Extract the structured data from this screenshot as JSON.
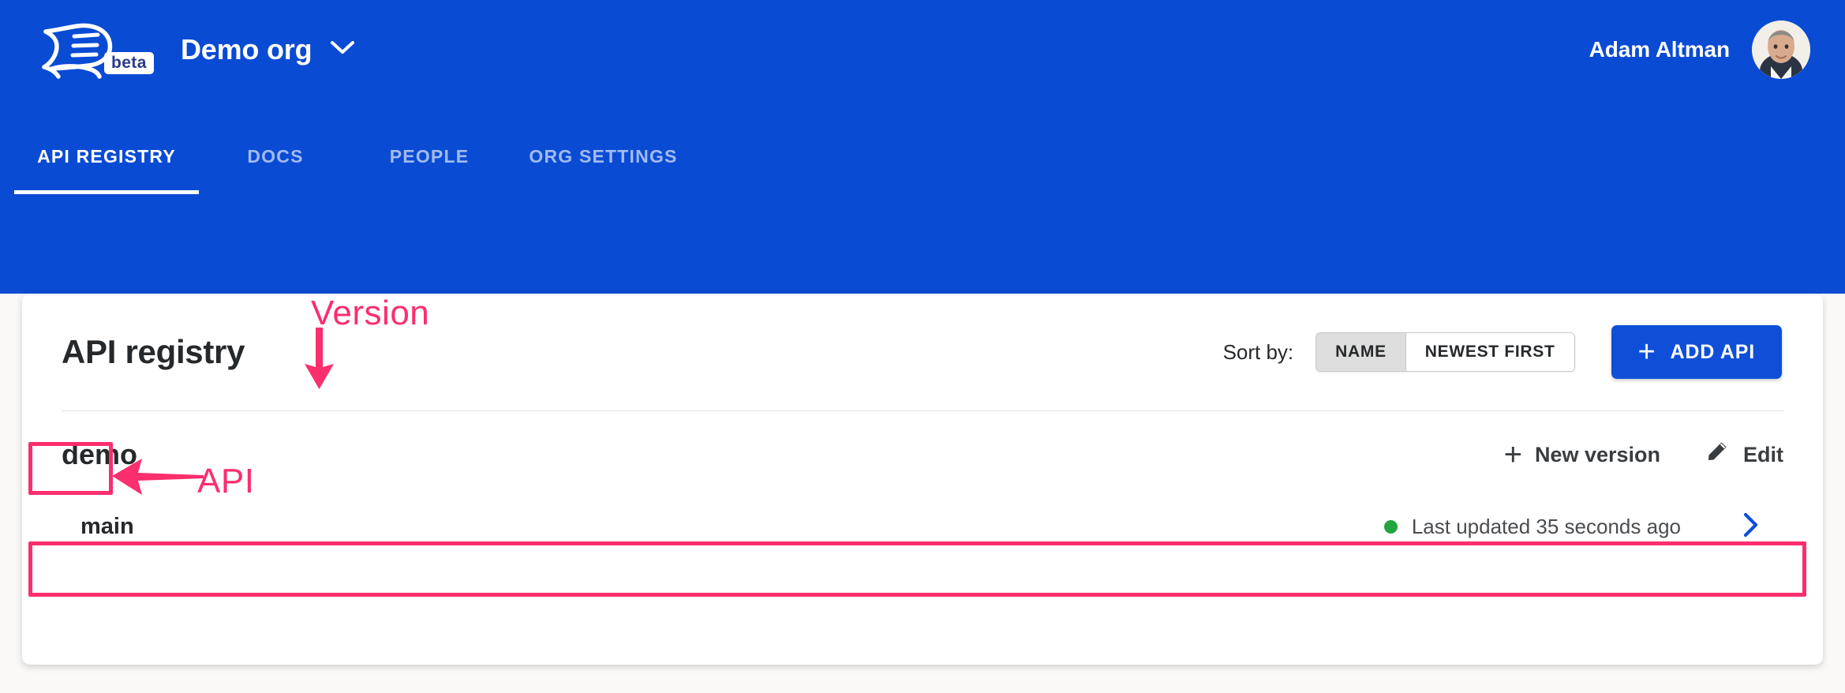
{
  "header": {
    "logo_alt": "API document logo",
    "beta_label": "beta",
    "org_name": "Demo org",
    "user_name": "Adam Altman"
  },
  "nav": {
    "tabs": [
      {
        "label": "API REGISTRY",
        "active": true
      },
      {
        "label": "DOCS",
        "active": false
      },
      {
        "label": "PEOPLE",
        "active": false
      },
      {
        "label": "ORG SETTINGS",
        "active": false
      }
    ]
  },
  "registry": {
    "title": "API registry",
    "sort_label": "Sort by:",
    "sort_options": [
      {
        "label": "NAME",
        "selected": true
      },
      {
        "label": "NEWEST FIRST",
        "selected": false
      }
    ],
    "add_api_label": "ADD API",
    "add_api_plus": "+",
    "apis": [
      {
        "name": "demo",
        "new_version_label": "New version",
        "new_version_plus": "+",
        "edit_label": "Edit",
        "versions": [
          {
            "name": "main",
            "status_text": "Last updated 35 seconds ago",
            "status_color": "#21a63f"
          }
        ]
      }
    ]
  },
  "annotations": [
    {
      "label": "API",
      "kind": "arrow-left"
    },
    {
      "label": "Version",
      "kind": "arrow-down"
    }
  ],
  "colors": {
    "header_blue": "#0a4bd4",
    "button_blue": "#0f4fd8",
    "annotation_pink": "#fb2e6e",
    "status_green": "#21a63f",
    "page_background": "#fbf8f8",
    "card_background": "#ffffff"
  }
}
